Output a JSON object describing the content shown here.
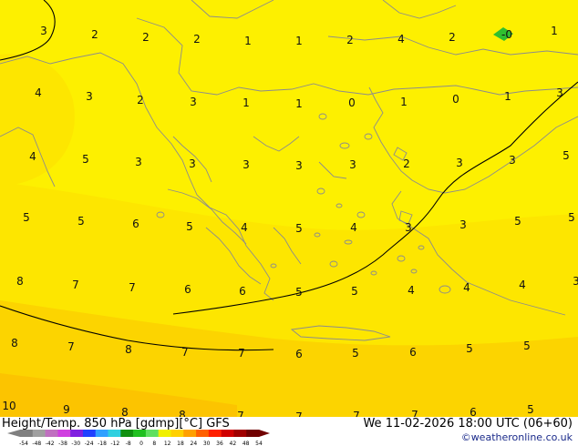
{
  "map": {
    "region": "Greece / Aegean",
    "colors": {
      "base_yellow": "#fdf000",
      "warm_yellow": "#fde000",
      "orange_yellow": "#fcc800",
      "coastline": "#8c8c8c",
      "isoline": "#000000",
      "cold_spot": "#2fbf2f"
    },
    "labels": [
      {
        "text": "3"
      },
      {
        "text": "2"
      },
      {
        "text": "2"
      },
      {
        "text": "2"
      },
      {
        "text": "1"
      },
      {
        "text": "1"
      },
      {
        "text": "2"
      },
      {
        "text": "4"
      },
      {
        "text": "2"
      },
      {
        "text": "-0"
      },
      {
        "text": "1"
      },
      {
        "text": "4"
      },
      {
        "text": "3"
      },
      {
        "text": "2"
      },
      {
        "text": "3"
      },
      {
        "text": "1"
      },
      {
        "text": "1"
      },
      {
        "text": "0"
      },
      {
        "text": "1"
      },
      {
        "text": "0"
      },
      {
        "text": "1"
      },
      {
        "text": "3"
      },
      {
        "text": "4"
      },
      {
        "text": "5"
      },
      {
        "text": "3"
      },
      {
        "text": "3"
      },
      {
        "text": "3"
      },
      {
        "text": "3"
      },
      {
        "text": "3"
      },
      {
        "text": "2"
      },
      {
        "text": "3"
      },
      {
        "text": "3"
      },
      {
        "text": "5"
      },
      {
        "text": "5"
      },
      {
        "text": "5"
      },
      {
        "text": "6"
      },
      {
        "text": "5"
      },
      {
        "text": "4"
      },
      {
        "text": "5"
      },
      {
        "text": "4"
      },
      {
        "text": "3"
      },
      {
        "text": "3"
      },
      {
        "text": "5"
      },
      {
        "text": "5"
      },
      {
        "text": "8"
      },
      {
        "text": "7"
      },
      {
        "text": "7"
      },
      {
        "text": "6"
      },
      {
        "text": "6"
      },
      {
        "text": "5"
      },
      {
        "text": "5"
      },
      {
        "text": "4"
      },
      {
        "text": "4"
      },
      {
        "text": "4"
      },
      {
        "text": "3"
      },
      {
        "text": "8"
      },
      {
        "text": "7"
      },
      {
        "text": "8"
      },
      {
        "text": "7"
      },
      {
        "text": "7"
      },
      {
        "text": "6"
      },
      {
        "text": "5"
      },
      {
        "text": "6"
      },
      {
        "text": "5"
      },
      {
        "text": "5"
      },
      {
        "text": "10"
      },
      {
        "text": "9"
      },
      {
        "text": "8"
      },
      {
        "text": "8"
      },
      {
        "text": "7"
      },
      {
        "text": "7"
      },
      {
        "text": "7"
      },
      {
        "text": "7"
      },
      {
        "text": "6"
      },
      {
        "text": "5"
      }
    ]
  },
  "footer": {
    "title": "Height/Temp. 850 hPa [gdmp][°C] GFS",
    "datetime": "We 11-02-2026 18:00 UTC (06+60)",
    "credit": "©weatheronline.co.uk"
  },
  "scale": {
    "ticks": [
      "-54",
      "-48",
      "-42",
      "-38",
      "-30",
      "-24",
      "-18",
      "-12",
      "-8",
      "0",
      "8",
      "12",
      "18",
      "24",
      "30",
      "36",
      "42",
      "48",
      "54"
    ],
    "colors": [
      "#808080",
      "#a0a0a0",
      "#c070c0",
      "#d040e0",
      "#8020e0",
      "#2040ff",
      "#30a0ff",
      "#30d0e0",
      "#109010",
      "#20c020",
      "#60e060",
      "#f0f000",
      "#ffd000",
      "#ffa000",
      "#ff6000",
      "#ff2000",
      "#d00000",
      "#a00000",
      "#700000"
    ]
  }
}
